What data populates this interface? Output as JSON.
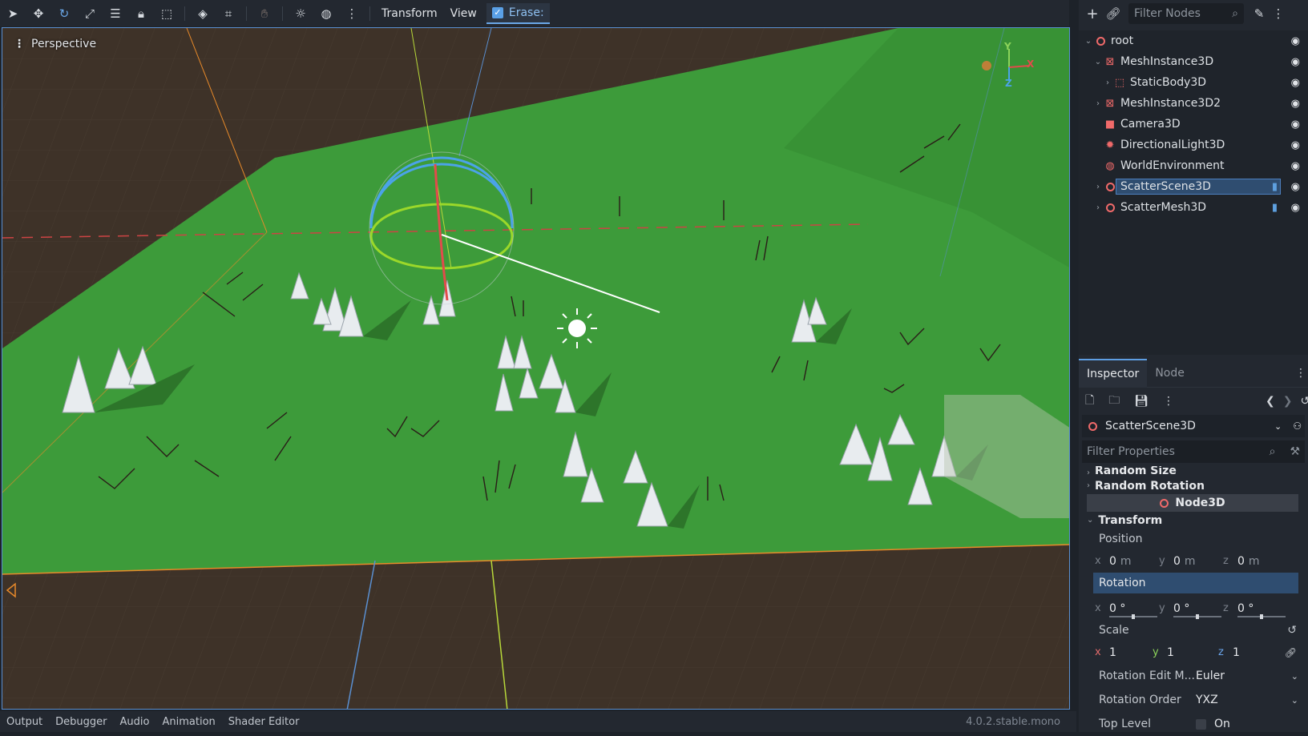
{
  "toolbar": {
    "icons": [
      "select-icon",
      "move-icon",
      "rotate-icon",
      "scale-icon",
      "list-select-icon",
      "lock-icon",
      "group-icon",
      "grid-snap-icon",
      "local-space-icon",
      "skeleton-icon",
      "sun-icon",
      "globe-icon",
      "more-icon"
    ],
    "menu_transform": "Transform",
    "menu_view": "View",
    "erase_label": "Erase:",
    "erase_checked": true
  },
  "viewport": {
    "label": "Perspective",
    "gizmo": {
      "y": "Y",
      "x": "X",
      "z": "Z"
    },
    "colors": {
      "ground": "#3d9b3a",
      "floor": "#3e3228",
      "sky": "#3e3228"
    }
  },
  "bottom": {
    "tabs": [
      "Output",
      "Debugger",
      "Audio",
      "Animation",
      "Shader Editor"
    ],
    "version": "4.0.2.stable.mono"
  },
  "scene": {
    "filter_placeholder": "Filter Nodes",
    "nodes": [
      {
        "label": "root",
        "icon": "node3d-icon",
        "depth": 0,
        "arrow": "v"
      },
      {
        "label": "MeshInstance3D",
        "icon": "mesh-icon",
        "depth": 1,
        "arrow": "v"
      },
      {
        "label": "StaticBody3D",
        "icon": "body-icon",
        "depth": 2,
        "arrow": ">"
      },
      {
        "label": "MeshInstance3D2",
        "icon": "mesh-icon",
        "depth": 1,
        "arrow": ">"
      },
      {
        "label": "Camera3D",
        "icon": "camera-icon",
        "depth": 1,
        "arrow": ""
      },
      {
        "label": "DirectionalLight3D",
        "icon": "light-icon",
        "depth": 1,
        "arrow": ""
      },
      {
        "label": "WorldEnvironment",
        "icon": "globe-icon",
        "depth": 1,
        "arrow": ""
      },
      {
        "label": "ScatterScene3D",
        "icon": "node3d-icon",
        "depth": 1,
        "arrow": ">",
        "selected": true,
        "script": true
      },
      {
        "label": "ScatterMesh3D",
        "icon": "node3d-icon",
        "depth": 1,
        "arrow": ">",
        "script": true
      }
    ]
  },
  "inspector": {
    "tab_inspector": "Inspector",
    "tab_node": "Node",
    "node_name": "ScatterScene3D",
    "filter_placeholder": "Filter Properties",
    "sections": {
      "random_size": "Random Size",
      "random_rotation": "Random Rotation",
      "node3d": "Node3D",
      "transform": "Transform"
    },
    "position": {
      "label": "Position",
      "x": "0",
      "y": "0",
      "z": "0",
      "unit": "m"
    },
    "rotation": {
      "label": "Rotation",
      "x": "0 °",
      "y": "0 °",
      "z": "0 °"
    },
    "scale": {
      "label": "Scale",
      "x": "1",
      "y": "1",
      "z": "1"
    },
    "rotation_edit_mode": {
      "label": "Rotation Edit M...",
      "value": "Euler"
    },
    "rotation_order": {
      "label": "Rotation Order",
      "value": "YXZ"
    },
    "top_level": {
      "label": "Top Level",
      "value": "On"
    }
  }
}
